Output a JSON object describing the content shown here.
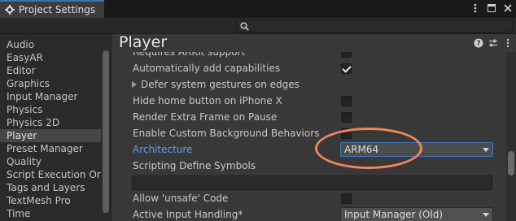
{
  "window": {
    "tab_title": "Project Settings",
    "search_placeholder": ""
  },
  "sidebar": {
    "items": [
      {
        "label": "Audio"
      },
      {
        "label": "EasyAR"
      },
      {
        "label": "Editor"
      },
      {
        "label": "Graphics"
      },
      {
        "label": "Input Manager"
      },
      {
        "label": "Physics"
      },
      {
        "label": "Physics 2D"
      },
      {
        "label": "Player",
        "selected": true
      },
      {
        "label": "Preset Manager"
      },
      {
        "label": "Quality"
      },
      {
        "label": "Script Execution Ord"
      },
      {
        "label": "Tags and Layers"
      },
      {
        "label": "TextMesh Pro"
      },
      {
        "label": "Time"
      }
    ]
  },
  "main": {
    "title": "Player",
    "rows": {
      "requires_arkit": {
        "label": "Requires ARKit support",
        "checked": false
      },
      "auto_caps": {
        "label": "Automatically add capabilities",
        "checked": true
      },
      "defer_gestures": {
        "label": "Defer system gestures on edges"
      },
      "hide_home": {
        "label": "Hide home button on iPhone X",
        "checked": false
      },
      "render_extra": {
        "label": "Render Extra Frame on Pause",
        "checked": false
      },
      "custom_bg": {
        "label": "Enable Custom Background Behaviors",
        "checked": false
      },
      "architecture": {
        "label": "Architecture",
        "value": "ARM64"
      },
      "scripting_define": {
        "label": "Scripting Define Symbols",
        "value": ""
      },
      "allow_unsafe": {
        "label": "Allow 'unsafe' Code",
        "checked": false
      },
      "active_input": {
        "label": "Active Input Handling*",
        "value": "Input Manager (Old)"
      }
    }
  },
  "colors": {
    "accent_link": "#5f9de6",
    "annotation": "#f0845a",
    "selected_bg": "#464646"
  }
}
